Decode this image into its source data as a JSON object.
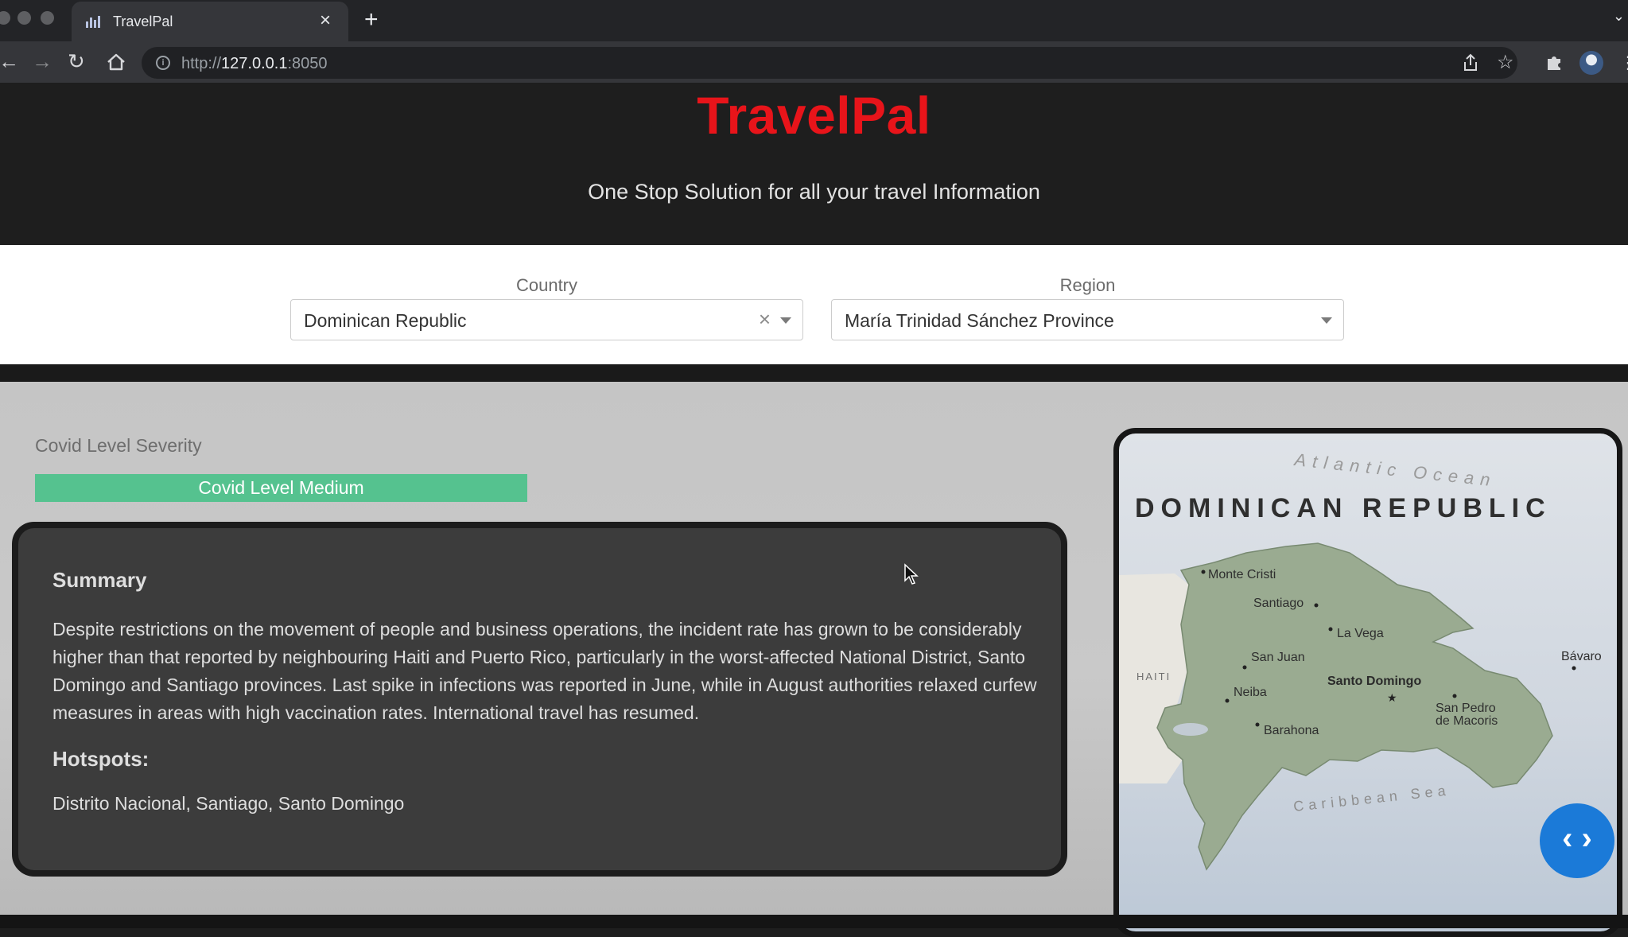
{
  "browser": {
    "tab_title": "TravelPal",
    "url_prefix": "http://",
    "url_host": "127.0.0.1",
    "url_suffix": ":8050"
  },
  "header": {
    "brand": "TravelPal",
    "tagline": "One Stop Solution for all your travel Information",
    "brand_color": "#e8141a"
  },
  "filters": {
    "country_label": "Country",
    "country_value": "Dominican Republic",
    "region_label": "Region",
    "region_value": "María Trinidad Sánchez Province"
  },
  "covid": {
    "section_label": "Covid Level Severity",
    "level_text": "Covid Level Medium",
    "level_color": "#55c28f"
  },
  "summary": {
    "title": "Summary",
    "text": "Despite restrictions on the movement of people and business operations, the incident rate has grown to be considerably higher than that reported by neighbouring Haiti and Puerto Rico, particularly in the worst-affected National District, Santo Domingo and Santiago provinces. Last spike in infections was reported in June, while in August authorities relaxed curfew measures in areas with high vaccination rates. International travel has resumed.",
    "hotspots_title": "Hotspots:",
    "hotspots_text": "Distrito Nacional, Santiago, Santo Domingo"
  },
  "map": {
    "title": "DOMINICAN REPUBLIC",
    "ocean_north": "Atlantic Ocean",
    "sea_south": "Caribbean Sea",
    "neighbor": "HAITI",
    "cities": {
      "monte_cristi": "Monte Cristi",
      "santiago": "Santiago",
      "la_vega": "La Vega",
      "san_juan": "San Juan",
      "santo_domingo": "Santo Domingo",
      "neiba": "Neiba",
      "barahona": "Barahona",
      "san_pedro_1": "San Pedro",
      "san_pedro_2": "de Macoris",
      "bavaro": "Bávaro"
    }
  }
}
